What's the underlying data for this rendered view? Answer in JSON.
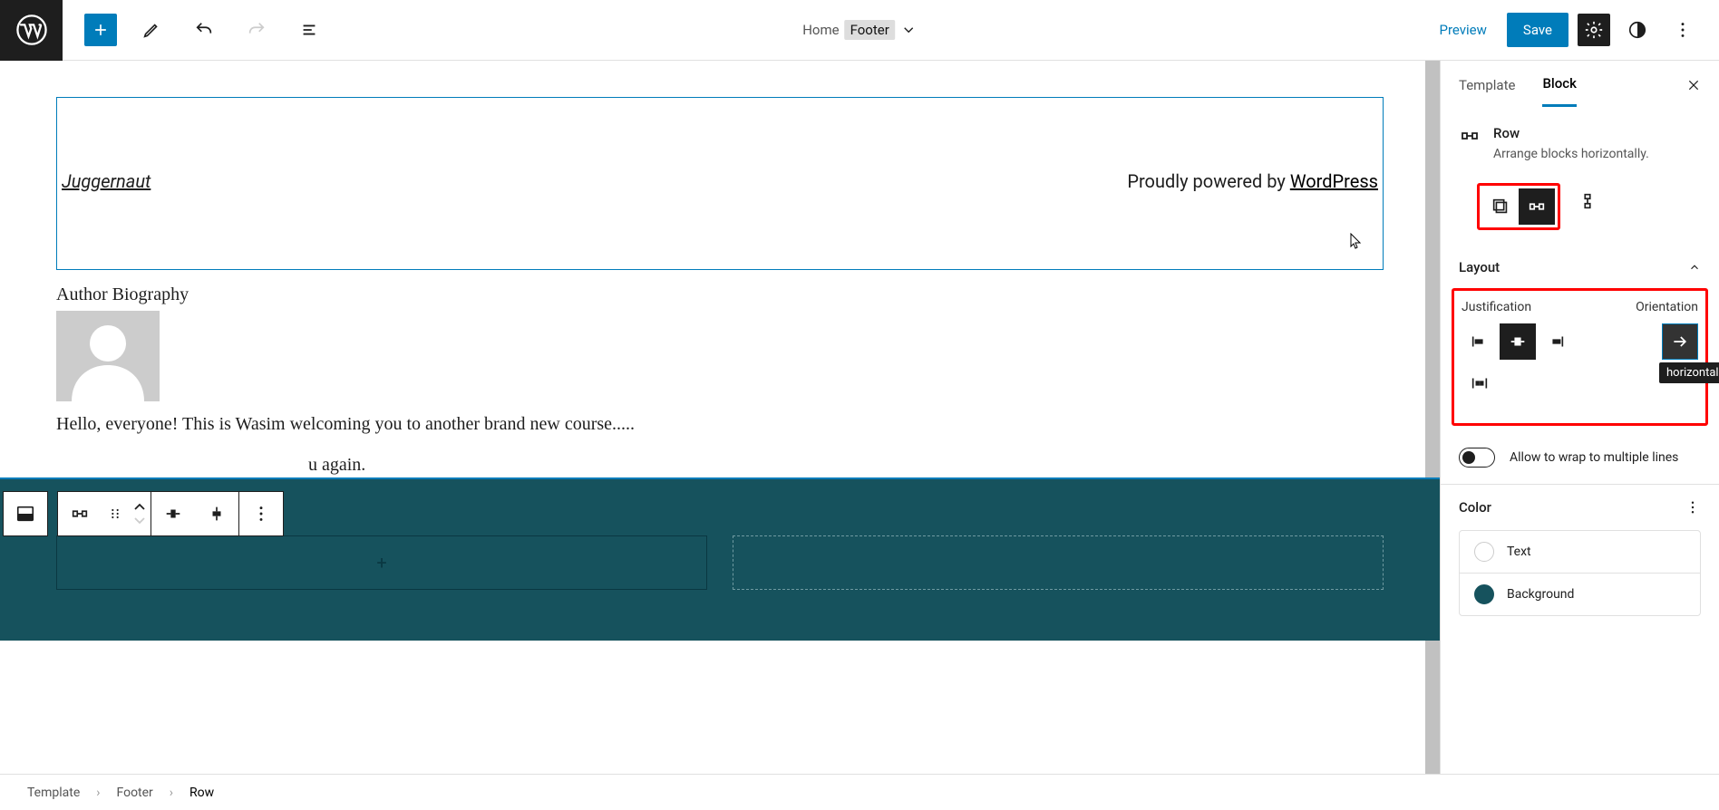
{
  "topbar": {
    "location": {
      "home": "Home",
      "part": "Footer"
    },
    "preview": "Preview",
    "save": "Save"
  },
  "canvas": {
    "site_title": "Juggernaut",
    "powered_prefix": "Proudly powered by ",
    "powered_link": "WordPress",
    "bio_heading": "Author Biography",
    "bio_line1": "Hello, everyone! This is Wasim welcoming you to another brand new course.....",
    "bio_line2": "u again.",
    "add_glyph": "+"
  },
  "sidebar": {
    "tabs": {
      "template": "Template",
      "block": "Block"
    },
    "block": {
      "title": "Row",
      "description": "Arrange blocks horizontally."
    },
    "layout": {
      "header": "Layout",
      "justification": "Justification",
      "orientation": "Orientation",
      "tooltip": "horizontal",
      "wrap_label": "Allow to wrap to multiple lines"
    },
    "color": {
      "header": "Color",
      "text": "Text",
      "background": "Background"
    }
  },
  "breadcrumb": {
    "a": "Template",
    "b": "Footer",
    "c": "Row"
  }
}
